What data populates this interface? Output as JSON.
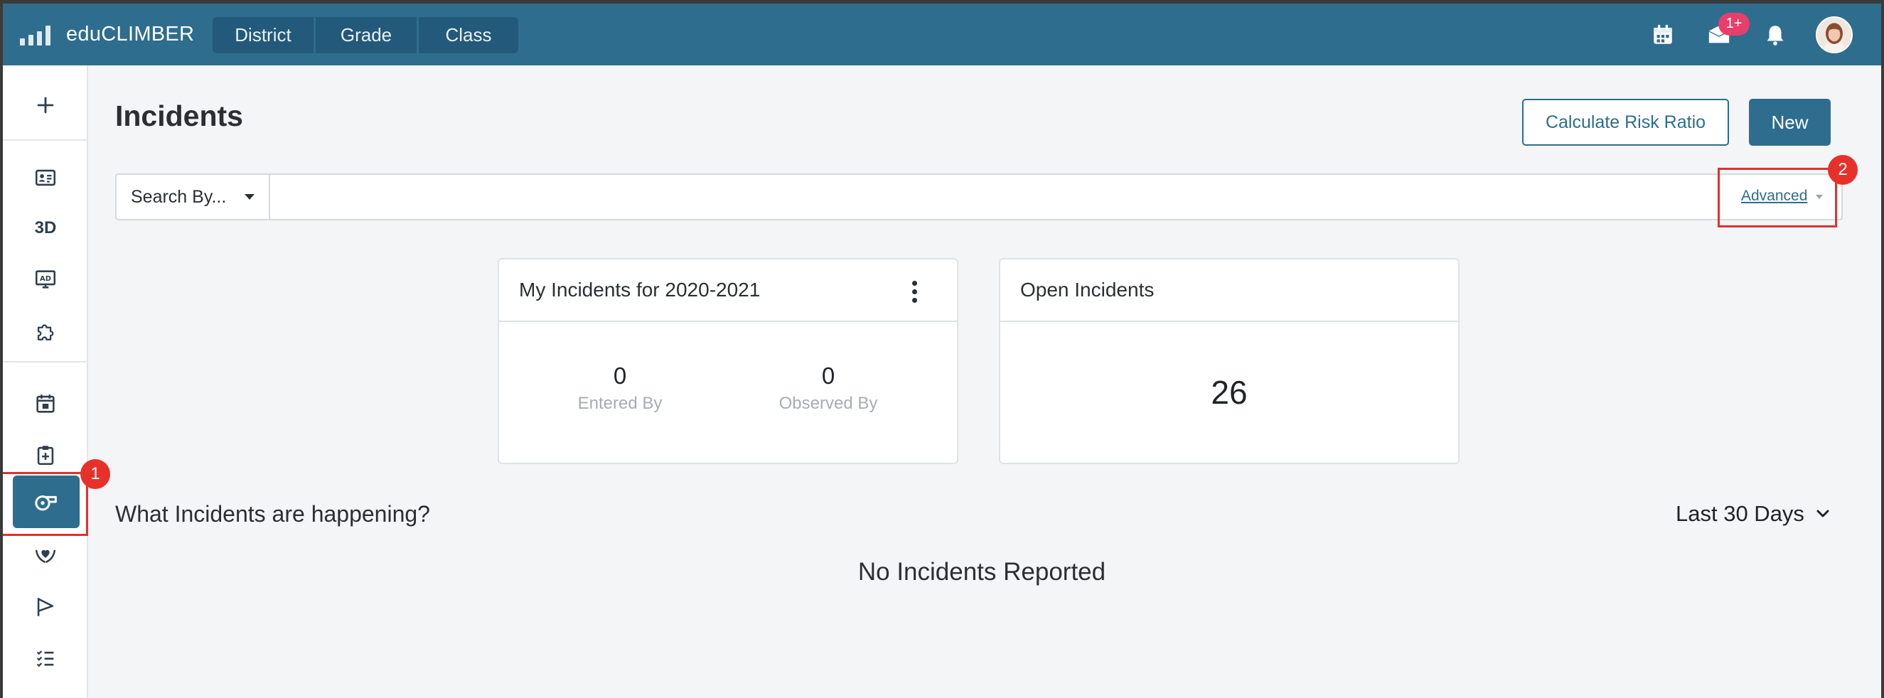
{
  "app": {
    "name": "eduCLIMBER",
    "scope_tabs": [
      "District",
      "Grade",
      "Class"
    ],
    "notification_badge": "1+"
  },
  "colors": {
    "brand": "#2e6d8e",
    "badge": "#e83e6c",
    "callout": "#e0322c"
  },
  "sidebar": {
    "items": [
      {
        "icon": "plus-icon"
      },
      {
        "icon": "student-card-icon"
      },
      {
        "label": "3D"
      },
      {
        "icon": "ad-monitor-icon"
      },
      {
        "icon": "puzzle-icon"
      },
      {
        "icon": "calendar-check-icon"
      },
      {
        "icon": "clipboard-plus-icon"
      },
      {
        "icon": "incident-whistle-icon",
        "active": true
      },
      {
        "icon": "hands-heart-icon"
      },
      {
        "icon": "flag-icon"
      },
      {
        "icon": "checklist-icon"
      }
    ]
  },
  "page": {
    "title": "Incidents",
    "calc_button": "Calculate Risk Ratio",
    "new_button": "New"
  },
  "search": {
    "by_label": "Search By...",
    "value": "",
    "advanced_label": "Advanced"
  },
  "cards": {
    "my_incidents": {
      "title": "My Incidents for 2020-2021",
      "entered_count": "0",
      "entered_label": "Entered By",
      "observed_count": "0",
      "observed_label": "Observed By"
    },
    "open_incidents": {
      "title": "Open Incidents",
      "count": "26"
    }
  },
  "happening": {
    "title": "What Incidents are happening?",
    "range": "Last 30 Days",
    "empty_message": "No Incidents Reported"
  },
  "callouts": [
    "1",
    "2"
  ]
}
